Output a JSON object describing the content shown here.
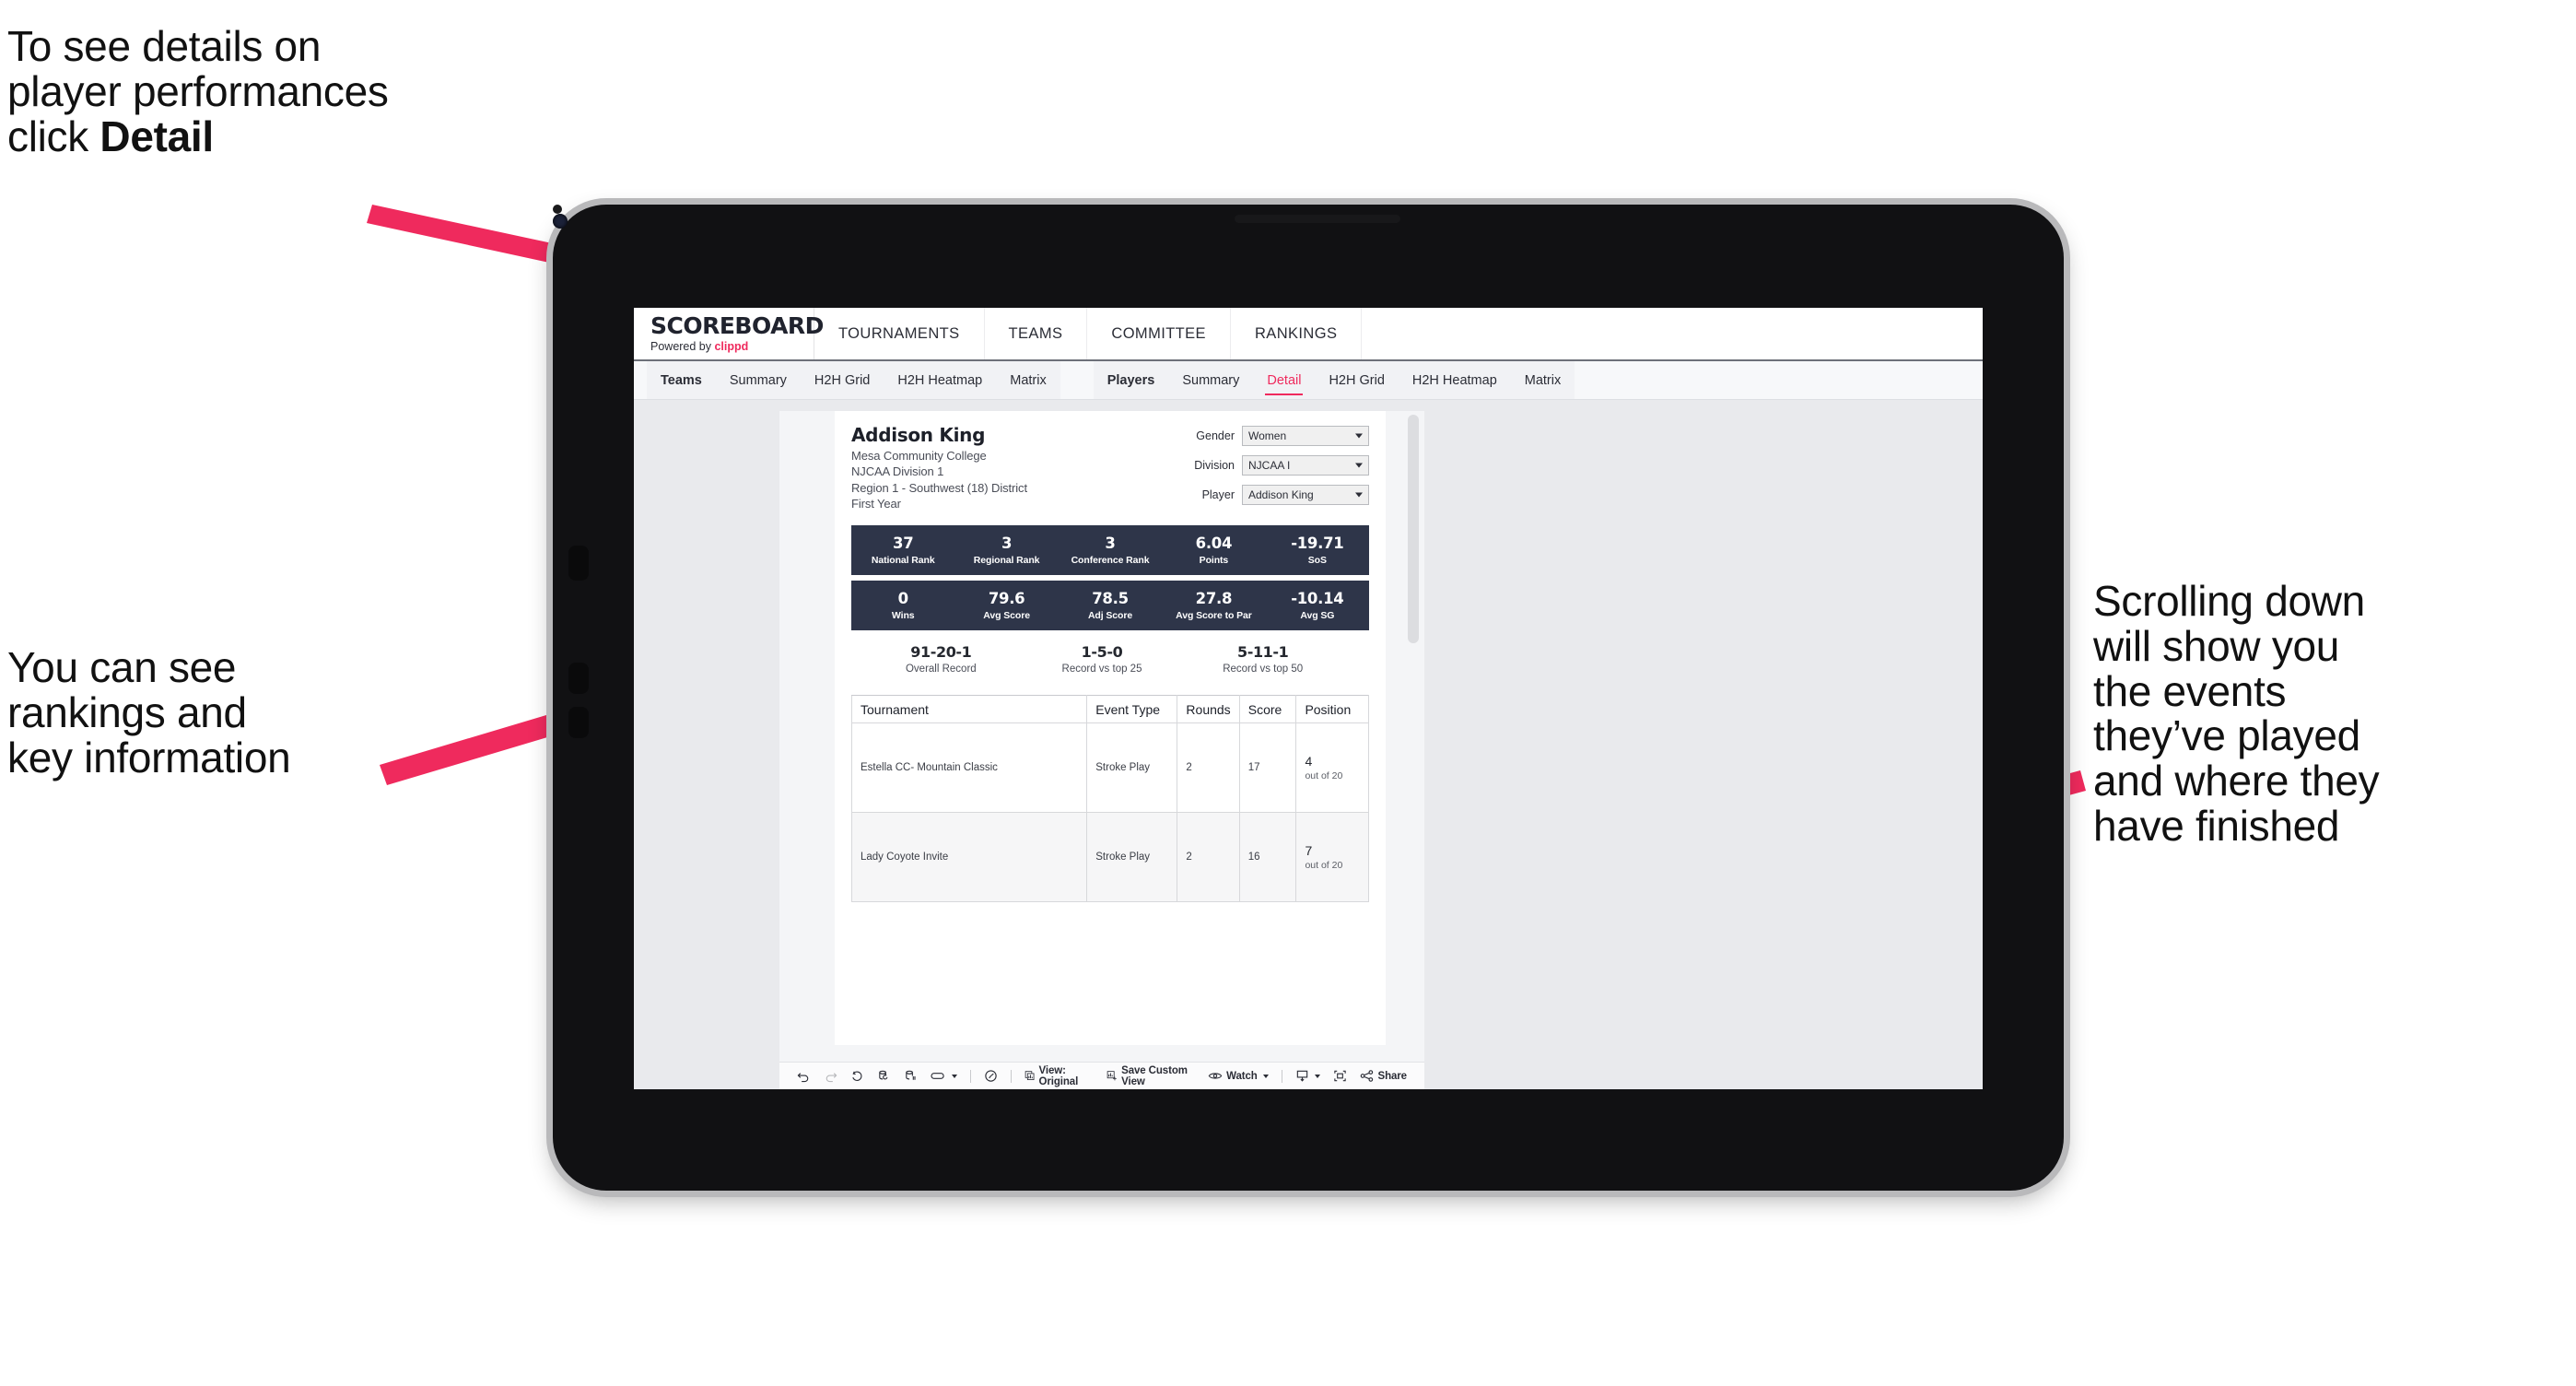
{
  "annotations": {
    "detail": "To see details on\nplayer performances\nclick ",
    "detail_bold": "Detail",
    "rankings": "You can see\nrankings and\nkey information",
    "scroll": "Scrolling down\nwill show you\nthe events\nthey’ve played\nand where they\nhave finished"
  },
  "colors": {
    "accent_pink": "#ef2a5d",
    "band_navy": "#2e3549",
    "page_gray": "#e9eaed"
  },
  "browser": {
    "brand": {
      "title": "SCOREBOARD",
      "powered_prefix": "Powered by ",
      "powered_brand": "clippd"
    },
    "top_nav": [
      "TOURNAMENTS",
      "TEAMS",
      "COMMITTEE",
      "RANKINGS"
    ],
    "tab_groups": [
      {
        "head": "Teams",
        "tabs": [
          "Summary",
          "H2H Grid",
          "H2H Heatmap",
          "Matrix"
        ]
      },
      {
        "head": "Players",
        "tabs": [
          "Summary",
          "Detail",
          "H2H Grid",
          "H2H Heatmap",
          "Matrix"
        ],
        "active": "Detail"
      }
    ]
  },
  "player": {
    "name": "Addison King",
    "meta": [
      "Mesa Community College",
      "NJCAA Division 1",
      "Region 1 - Southwest (18) District",
      "First Year"
    ]
  },
  "filters": [
    {
      "label": "Gender",
      "value": "Women"
    },
    {
      "label": "Division",
      "value": "NJCAA I"
    },
    {
      "label": "Player",
      "value": "Addison King"
    }
  ],
  "stat_bands": [
    [
      {
        "value": "37",
        "label": "National Rank"
      },
      {
        "value": "3",
        "label": "Regional Rank"
      },
      {
        "value": "3",
        "label": "Conference Rank"
      },
      {
        "value": "6.04",
        "label": "Points"
      },
      {
        "value": "-19.71",
        "label": "SoS"
      }
    ],
    [
      {
        "value": "0",
        "label": "Wins"
      },
      {
        "value": "79.6",
        "label": "Avg Score"
      },
      {
        "value": "78.5",
        "label": "Adj Score"
      },
      {
        "value": "27.8",
        "label": "Avg Score to Par"
      },
      {
        "value": "-10.14",
        "label": "Avg SG"
      }
    ]
  ],
  "records": [
    {
      "value": "91-20-1",
      "label": "Overall Record"
    },
    {
      "value": "1-5-0",
      "label": "Record vs top 25"
    },
    {
      "value": "5-11-1",
      "label": "Record vs top 50"
    }
  ],
  "events_table": {
    "columns": [
      "Tournament",
      "Event Type",
      "Rounds",
      "Score",
      "Position"
    ],
    "rows": [
      {
        "tournament": "Estella CC- Mountain Classic",
        "event_type": "Stroke Play",
        "rounds": "2",
        "score": "17",
        "position": "4",
        "position_sub": "out of 20"
      },
      {
        "tournament": "Lady Coyote Invite",
        "event_type": "Stroke Play",
        "rounds": "2",
        "score": "16",
        "position": "7",
        "position_sub": "out of 20"
      }
    ]
  },
  "toolbar": {
    "view_label": "View: Original",
    "save_label": "Save Custom View",
    "watch_label": "Watch",
    "share_label": "Share"
  }
}
